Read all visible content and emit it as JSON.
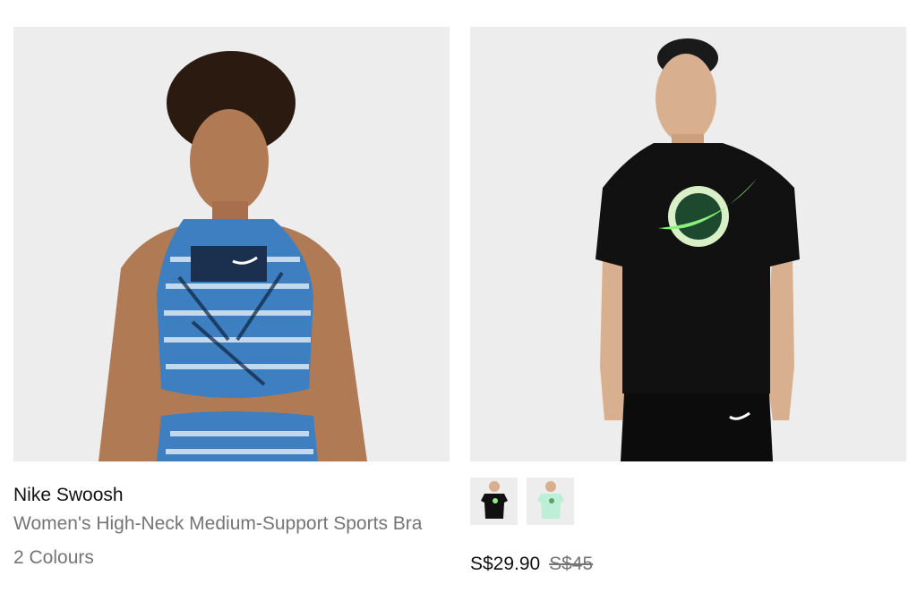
{
  "products": [
    {
      "name": "Nike Swoosh",
      "subtitle": "Women's High-Neck Medium-Support Sports Bra",
      "colours": "2 Colours",
      "image": "product-photo-sports-bra"
    },
    {
      "image": "product-photo-tshirt",
      "variants": [
        "thumbnail-black-tshirt",
        "thumbnail-mint-tshirt"
      ],
      "price": "S$29.90",
      "old_price": "S$45"
    }
  ],
  "colors": {
    "text_primary": "#111111",
    "text_secondary": "#757575",
    "image_bg": "#efefef"
  }
}
